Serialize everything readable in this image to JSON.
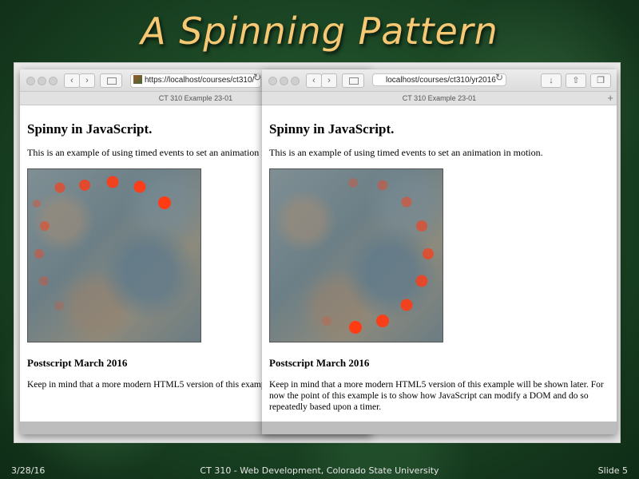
{
  "slide": {
    "title": "A Spinning Pattern",
    "date": "3/28/16",
    "course": "CT 310 - Web Development, Colorado State University",
    "slide_number": "Slide 5"
  },
  "browser_left": {
    "url": "https://localhost/courses/ct310/",
    "tab_title": "CT 310 Example 23-01"
  },
  "browser_right": {
    "url": "localhost/courses/ct310/yr2016",
    "tab_title": "CT 310 Example 23-01"
  },
  "page": {
    "heading": "Spinny in JavaScript.",
    "intro": "This is an example of using timed events to set an animation in motion.",
    "postscript_heading": "Postscript March 2016",
    "postscript_text": "Keep in mind that a more modern HTML5 version of this example will be shown later. For now the point of this example is to show how JavaScript can modify a DOM and do so repeatedly based upon a timer."
  },
  "colors": {
    "title": "#f6c874",
    "dot": "#ff3b14"
  },
  "icons": {
    "back": "chevron-left-icon",
    "forward": "chevron-right-icon",
    "sidebar": "sidebar-icon",
    "reload": "reload-icon",
    "download": "download-icon",
    "share": "share-icon",
    "tabs": "tabs-icon",
    "new_tab": "plus-icon"
  }
}
